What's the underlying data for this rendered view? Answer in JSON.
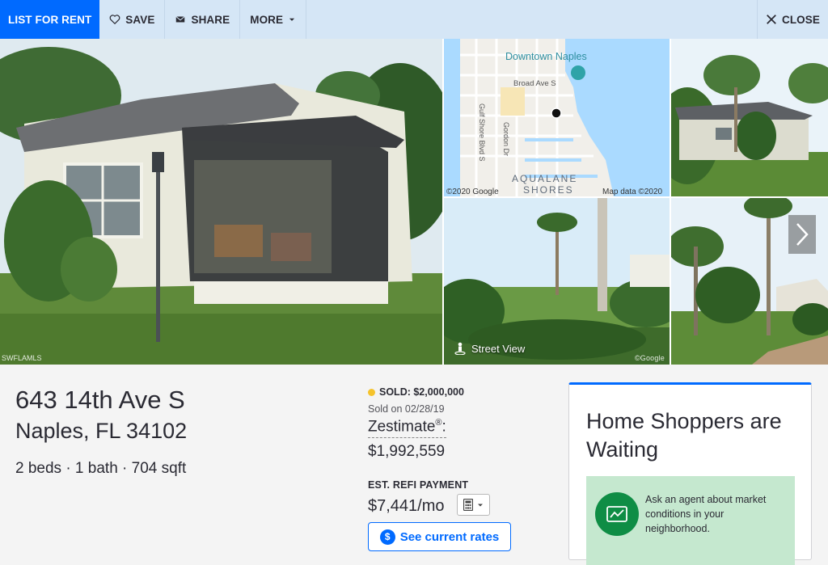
{
  "toolbar": {
    "list_for_rent": "LIST FOR RENT",
    "save": "SAVE",
    "share": "SHARE",
    "more": "MORE",
    "close": "CLOSE"
  },
  "photos": {
    "main_watermark": "SWFLAMLS",
    "map": {
      "place_label": "Downtown Naples",
      "street_1": "Broad Ave S",
      "street_2": "Gulf Shore Blvd S",
      "street_3": "Gordon Dr",
      "area_label_1": "AQUALANE",
      "area_label_2": "SHORES",
      "copyright": "©2020 Google",
      "map_data": "Map data ©2020"
    },
    "street_view_label": "Street View",
    "street_view_watermark": "©Google"
  },
  "listing": {
    "address_line1": "643 14th Ave S",
    "address_line2": "Naples, FL 34102",
    "facts": "2 beds · 1 bath · 704 sqft",
    "status": "SOLD: $2,000,000",
    "sold_on": "Sold on 02/28/19",
    "zestimate_label": "Zestimate",
    "zestimate_mark": "®",
    "zestimate_colon": ":",
    "zestimate_value": "$1,992,559",
    "refi_label": "EST. REFI PAYMENT",
    "refi_value": "$7,441/mo",
    "rates_button": "See current rates",
    "rates_icon_text": "$"
  },
  "card": {
    "title": "Home Shoppers are Waiting",
    "promo_text": "Ask an agent about market conditions in your neighborhood."
  },
  "colors": {
    "accent": "#006aff",
    "toolbar_bg": "#d5e6f6",
    "sold_dot": "#f5c32c",
    "promo_bg": "#c5e8cf",
    "promo_icon_bg": "#0f8d45"
  }
}
